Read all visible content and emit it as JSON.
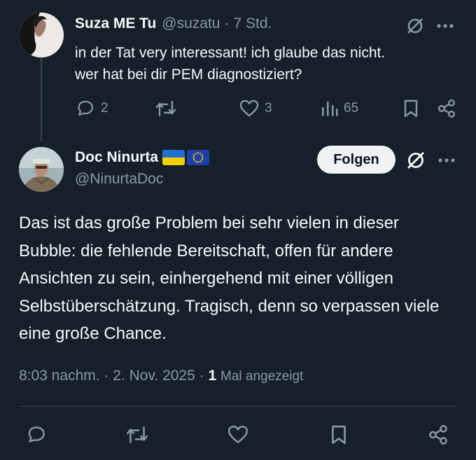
{
  "reply": {
    "name": "Suza ME Tu",
    "handle": "@suzatu",
    "separator": "·",
    "time": "7 Std.",
    "text_line1": "in der Tat very interessant! ich glaube das nicht.",
    "text_line2": "wer hat bei dir PEM diagnostiziert?",
    "replies_count": "2",
    "likes_count": "3",
    "views_count": "65"
  },
  "tweet": {
    "name": "Doc Ninurta",
    "handle": "@NinurtaDoc",
    "follow_label": "Folgen",
    "text": "Das ist das große Problem bei sehr vielen in dieser Bubble: die fehlende Bereitschaft, offen für andere Ansichten zu sein, einhergehend mit einer völligen Selbstüberschätzung. Tragisch, denn so verpassen viele eine große Chance.",
    "time": "8:03 nachm.",
    "separator": "·",
    "date": "2. Nov. 2025",
    "views_count": "1",
    "views_label": "Mal angezeigt"
  },
  "flags": [
    "ukraine-flag-icon",
    "eu-flag-icon"
  ],
  "colors": {
    "background": "#15202b",
    "text_primary": "#f7f9f9",
    "text_secondary": "#8b98a5",
    "divider": "#38444d",
    "follow_bg": "#eff3f4"
  }
}
